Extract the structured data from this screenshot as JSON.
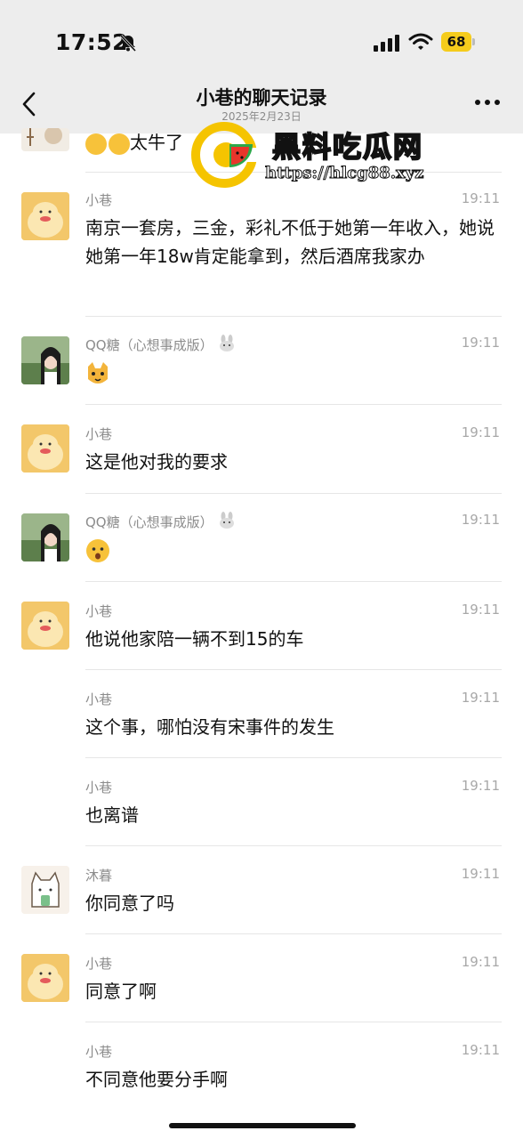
{
  "status": {
    "time": "17:52",
    "battery": "68"
  },
  "header": {
    "title": "小巷的聊天记录",
    "date": "2025年2月23日"
  },
  "watermark": {
    "title": "黑料吃瓜网",
    "url": "https://hlcg88.xyz"
  },
  "top_partial": {
    "text": "太牛了"
  },
  "messages": [
    {
      "sender": "小巷",
      "time": "19:11",
      "text": "南京一套房，三金，彩礼不低于她第一年收入，她说她第一年18w肯定能拿到，然后酒席我家办"
    },
    {
      "sender": "QQ糖（心想事成版）",
      "time": "19:11",
      "text": ""
    },
    {
      "sender": "小巷",
      "time": "19:11",
      "text": "这是他对我的要求"
    },
    {
      "sender": "QQ糖（心想事成版）",
      "time": "19:11",
      "text": ""
    },
    {
      "sender": "小巷",
      "time": "19:11",
      "text": "他说他家陪一辆不到15的车"
    },
    {
      "sender": "小巷",
      "time": "19:11",
      "text": "这个事，哪怕没有宋事件的发生"
    },
    {
      "sender": "小巷",
      "time": "19:11",
      "text": "也离谱"
    },
    {
      "sender": "沐暮",
      "time": "19:11",
      "text": "你同意了吗"
    },
    {
      "sender": "小巷",
      "time": "19:11",
      "text": "同意了啊"
    },
    {
      "sender": "小巷",
      "time": "19:11",
      "text": "不同意他要分手啊"
    }
  ]
}
